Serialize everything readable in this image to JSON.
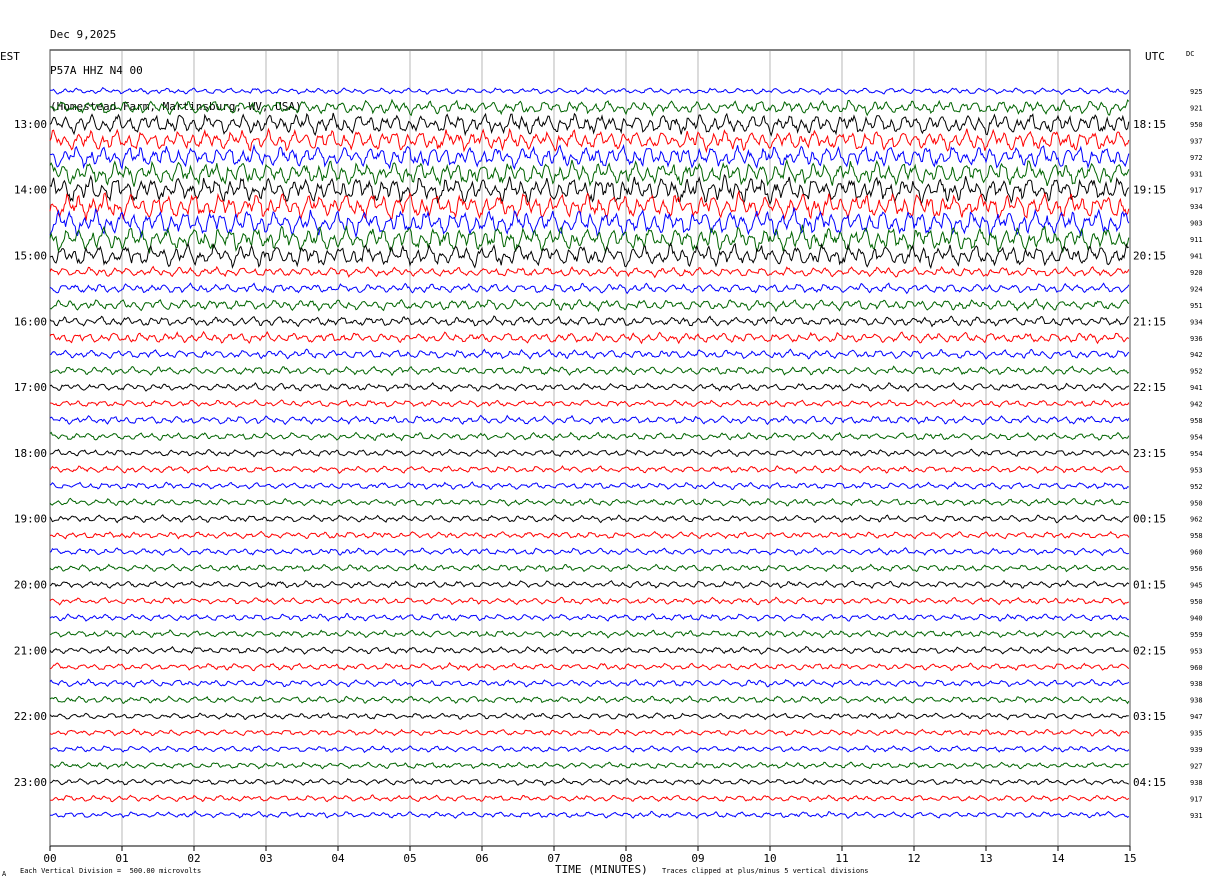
{
  "header": {
    "date": "Dec 9,2025",
    "station": "P57A HHZ N4 00",
    "location": "(Homestead Farm, Martinsburg, WV, USA)"
  },
  "left_timezone": "EST",
  "right_timezone": "UTC",
  "dc_label": "DC",
  "footer": {
    "left_mark": "A",
    "scale_note": "Each Vertical Division =  500.00 microvolts",
    "clip_note": "Traces clipped at plus/minus 5 vertical divisions"
  },
  "chart_data": {
    "type": "line",
    "xlabel": "TIME (MINUTES)",
    "x_ticks": [
      "00",
      "01",
      "02",
      "03",
      "04",
      "05",
      "06",
      "07",
      "08",
      "09",
      "10",
      "11",
      "12",
      "13",
      "14",
      "15"
    ],
    "xlim": [
      0,
      15
    ],
    "left_hour_labels": [
      "13:00",
      "14:00",
      "15:00",
      "16:00",
      "17:00",
      "18:00",
      "19:00",
      "20:00",
      "21:00",
      "22:00",
      "23:00"
    ],
    "right_hour_labels": [
      "18:15",
      "19:15",
      "20:15",
      "21:15",
      "22:15",
      "23:15",
      "00:15",
      "01:15",
      "02:15",
      "03:15",
      "04:15"
    ],
    "trace_colors": [
      "#0000ff",
      "#006400",
      "#000000",
      "#ff0000"
    ],
    "first_trace_color_index": 0,
    "dc_offsets": [
      "925",
      "921",
      "950",
      "937",
      "972",
      "931",
      "917",
      "934",
      "903",
      "911",
      "941",
      "920",
      "924",
      "951",
      "934",
      "936",
      "942",
      "952",
      "941",
      "942",
      "958",
      "954",
      "954",
      "953",
      "952",
      "950",
      "962",
      "958",
      "960",
      "956",
      "945",
      "950",
      "940",
      "959",
      "953",
      "960",
      "938",
      "938",
      "947",
      "935",
      "939",
      "927",
      "938",
      "917",
      "931"
    ],
    "trace_amplitude_scale": [
      0.45,
      1.0,
      1.5,
      1.5,
      1.6,
      1.7,
      1.9,
      1.9,
      1.9,
      1.8,
      1.6,
      0.7,
      0.7,
      0.8,
      0.7,
      0.75,
      0.65,
      0.6,
      0.55,
      0.5,
      0.6,
      0.55,
      0.5,
      0.5,
      0.5,
      0.5,
      0.5,
      0.5,
      0.5,
      0.5,
      0.5,
      0.5,
      0.5,
      0.5,
      0.5,
      0.5,
      0.5,
      0.5,
      0.45,
      0.45,
      0.45,
      0.45,
      0.45,
      0.45,
      0.45
    ],
    "grid": true
  }
}
